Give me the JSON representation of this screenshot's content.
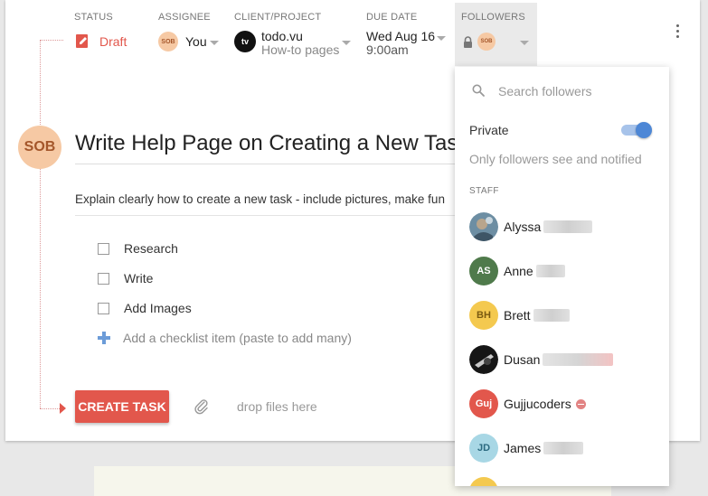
{
  "header": {
    "status": {
      "label": "STATUS",
      "value": "Draft",
      "icon": "pencil-icon",
      "color": "#e2574c"
    },
    "assignee": {
      "label": "ASSIGNEE",
      "value": "You",
      "avatar_initials": "SOB"
    },
    "client_project": {
      "label": "CLIENT/PROJECT",
      "client": "todo.vu",
      "project": "How-to pages",
      "avatar_text": "tv"
    },
    "due_date": {
      "label": "DUE DATE",
      "date": "Wed Aug 16",
      "time": "9:00am"
    },
    "followers": {
      "label": "FOLLOWERS",
      "lock_icon": "lock-icon",
      "avatar_initials": "SOB"
    }
  },
  "task": {
    "avatar_initials": "SOB",
    "title": "Write Help Page on Creating a New Task",
    "description": "Explain clearly how to create a new task - include pictures, make fun",
    "checklist": [
      "Research",
      "Write",
      "Add Images"
    ],
    "add_checklist_placeholder": "Add a checklist item (paste to add many)",
    "create_button": "CREATE TASK",
    "drop_files": "drop files here"
  },
  "followers_dropdown": {
    "search_placeholder": "Search followers",
    "private_label": "Private",
    "private_enabled": true,
    "private_note": "Only followers see and notified",
    "staff_label": "STAFF",
    "people": [
      {
        "name": "Alyssa",
        "initials": "",
        "bg": "#7a95a8",
        "fg": "#ffffff",
        "photo": true
      },
      {
        "name": "Anne",
        "initials": "AS",
        "bg": "#4f7a4b",
        "fg": "#ffffff"
      },
      {
        "name": "Brett",
        "initials": "BH",
        "bg": "#f4c94f",
        "fg": "#7a5a10"
      },
      {
        "name": "Dusan",
        "initials": "",
        "bg": "#1a1a1a",
        "fg": "#ffffff",
        "photo": true
      },
      {
        "name": "Gujjucoders",
        "initials": "Guj",
        "bg": "#e2574c",
        "fg": "#ffffff",
        "badge": "minus"
      },
      {
        "name": "James",
        "initials": "JD",
        "bg": "#a8d7e5",
        "fg": "#2b6a80"
      }
    ]
  },
  "colors": {
    "accent": "#e2574c",
    "toggle": "#4d87d6",
    "plus": "#6c9cd8"
  }
}
